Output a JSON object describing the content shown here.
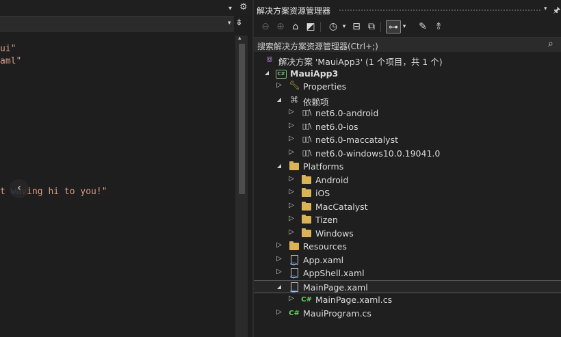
{
  "editor": {
    "code_lines": [
      "ui\"",
      "aml\"",
      "t waving hi to you!\""
    ],
    "collapse_glyph": "‹",
    "gear_glyph": "⚙",
    "dropdown_glyph": "▾",
    "split_glyph": "⇟",
    "scroll_up_glyph": "▴",
    "code_string_color": "#d69d85"
  },
  "solution_explorer": {
    "title": "解决方案资源管理器",
    "pin_glyph": "ᵖ",
    "search_label": "搜索解决方案资源管理器(Ctrl+;)",
    "search_icon_glyph": "⌕",
    "toolbar": [
      {
        "name": "back-icon",
        "glyph": "⊖",
        "enabled": false
      },
      {
        "name": "forward-icon",
        "glyph": "⊕",
        "enabled": false
      },
      {
        "name": "home-icon",
        "glyph": "⌂",
        "enabled": true
      },
      {
        "name": "vs-switch-views-icon",
        "glyph": "◩",
        "enabled": true
      },
      {
        "name": "history-icon",
        "glyph": "◷",
        "enabled": true
      },
      {
        "name": "history-dropdown-icon",
        "glyph": "▾",
        "enabled": true
      },
      {
        "name": "collapse-all-icon",
        "glyph": "⊟",
        "enabled": true
      },
      {
        "name": "copy-pages-icon",
        "glyph": "⧉",
        "enabled": true
      },
      {
        "name": "show-all-files-icon",
        "glyph": "⊶",
        "enabled": true
      },
      {
        "name": "show-all-dropdown-icon",
        "glyph": "▾",
        "enabled": true
      },
      {
        "name": "properties-wrench-icon",
        "glyph": "✎",
        "enabled": true
      },
      {
        "name": "preview-icon",
        "glyph": "⥉",
        "enabled": true
      }
    ],
    "tree": [
      {
        "label": "解决方案 'MauiApp3' (1 个项目，共 1 个)",
        "icon": "solution",
        "level": 0,
        "expander": "none"
      },
      {
        "label": "MauiApp3",
        "icon": "csproj",
        "level": 1,
        "expander": "expanded",
        "bold": true
      },
      {
        "label": "Properties",
        "icon": "properties",
        "level": 2,
        "expander": "collapsed"
      },
      {
        "label": "依赖项",
        "icon": "dependencies",
        "level": 2,
        "expander": "expanded"
      },
      {
        "label": "net6.0-android",
        "icon": "framework",
        "level": 3,
        "expander": "collapsed"
      },
      {
        "label": "net6.0-ios",
        "icon": "framework",
        "level": 3,
        "expander": "collapsed"
      },
      {
        "label": "net6.0-maccatalyst",
        "icon": "framework",
        "level": 3,
        "expander": "collapsed"
      },
      {
        "label": "net6.0-windows10.0.19041.0",
        "icon": "framework",
        "level": 3,
        "expander": "collapsed"
      },
      {
        "label": "Platforms",
        "icon": "folder",
        "level": 2,
        "expander": "expanded"
      },
      {
        "label": "Android",
        "icon": "folder",
        "level": 3,
        "expander": "collapsed"
      },
      {
        "label": "iOS",
        "icon": "folder",
        "level": 3,
        "expander": "collapsed"
      },
      {
        "label": "MacCatalyst",
        "icon": "folder",
        "level": 3,
        "expander": "collapsed"
      },
      {
        "label": "Tizen",
        "icon": "folder",
        "level": 3,
        "expander": "collapsed"
      },
      {
        "label": "Windows",
        "icon": "folder",
        "level": 3,
        "expander": "collapsed"
      },
      {
        "label": "Resources",
        "icon": "folder",
        "level": 2,
        "expander": "collapsed"
      },
      {
        "label": "App.xaml",
        "icon": "xaml",
        "level": 2,
        "expander": "collapsed"
      },
      {
        "label": "AppShell.xaml",
        "icon": "xaml",
        "level": 2,
        "expander": "collapsed"
      },
      {
        "label": "MainPage.xaml",
        "icon": "xaml",
        "level": 2,
        "expander": "expanded",
        "selected": true
      },
      {
        "label": "MainPage.xaml.cs",
        "icon": "csharp",
        "level": 3,
        "expander": "collapsed"
      },
      {
        "label": "MauiProgram.cs",
        "icon": "csharp",
        "level": 2,
        "expander": "collapsed"
      }
    ]
  },
  "colors": {
    "background": "#1f1f1f",
    "folder": "#d8b457",
    "csharp": "#5fce5f",
    "solution": "#b180d7",
    "text": "#dadada"
  }
}
